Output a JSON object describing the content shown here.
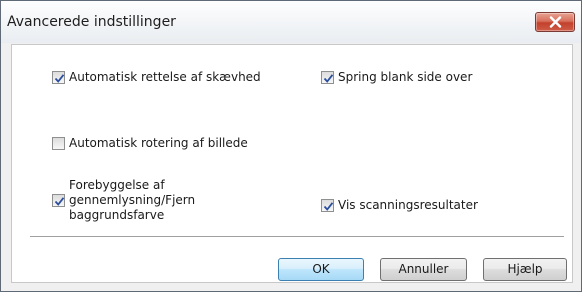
{
  "window": {
    "title": "Avancerede indstillinger",
    "close_icon": "close-x-icon"
  },
  "options": {
    "skew_correction": {
      "label": "Automatisk rettelse af skævhed",
      "checked": true
    },
    "skip_blank": {
      "label": "Spring blank side over",
      "checked": true
    },
    "auto_rotate": {
      "label": "Automatisk rotering af billede",
      "checked": false
    },
    "bleed_through": {
      "label": "Forebyggelse af\ngennemlysning/Fjern\nbaggrundsfarve",
      "checked": true
    },
    "show_results": {
      "label": "Vis scanningsresultater",
      "checked": true
    }
  },
  "buttons": {
    "ok": "OK",
    "cancel": "Annuller",
    "help": "Hjælp"
  },
  "colors": {
    "checkmark": "#2b4f9e",
    "close_button": "#c8503b"
  }
}
